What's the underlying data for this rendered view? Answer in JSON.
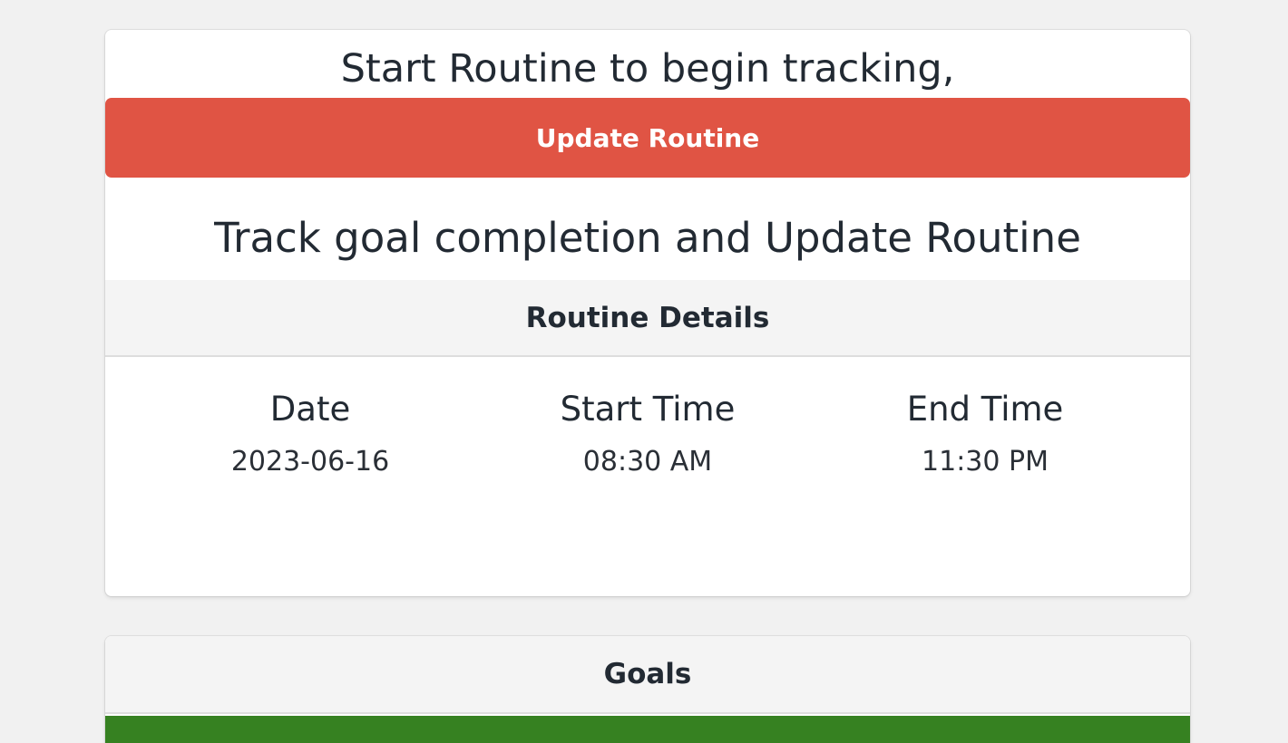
{
  "main": {
    "intro_text": "Start Routine to begin tracking,",
    "update_button_label": "Update Routine",
    "track_heading": "Track goal completion and Update Routine",
    "details_header": "Routine Details",
    "details": [
      {
        "label": "Date",
        "value": "2023-06-16"
      },
      {
        "label": "Start Time",
        "value": "08:30 AM"
      },
      {
        "label": "End Time",
        "value": "11:30 PM"
      }
    ]
  },
  "goals": {
    "header": "Goals"
  },
  "colors": {
    "update_button": "#e05444",
    "goal_bar": "#368121",
    "page_background": "#f1f1f1"
  }
}
